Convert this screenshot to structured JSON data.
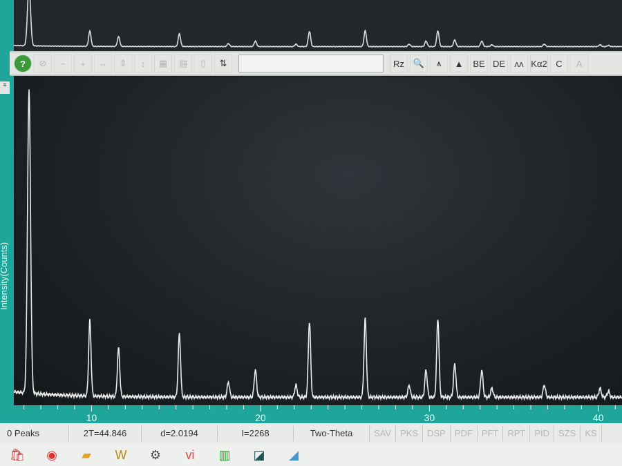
{
  "toolbar": {
    "buttons": [
      {
        "name": "help",
        "glyph": "?",
        "active": true
      },
      {
        "name": "stop",
        "glyph": "⊘",
        "active": false
      },
      {
        "name": "minus",
        "glyph": "−",
        "active": false
      },
      {
        "name": "plus",
        "glyph": "+",
        "active": false
      },
      {
        "name": "expand-h",
        "glyph": "⇔",
        "active": false
      },
      {
        "name": "expand-v",
        "glyph": "⇕",
        "active": false
      },
      {
        "name": "scale-v",
        "glyph": "↕",
        "active": false
      },
      {
        "name": "grid",
        "glyph": "▦",
        "active": false
      },
      {
        "name": "grid2",
        "glyph": "▤",
        "active": false
      },
      {
        "name": "blank",
        "glyph": "▯",
        "active": false
      },
      {
        "name": "spin",
        "glyph": "⇅",
        "active": true
      }
    ],
    "right_buttons": [
      {
        "name": "rz",
        "glyph": "Rz",
        "active": true
      },
      {
        "name": "zoom",
        "glyph": "🔍",
        "active": true
      },
      {
        "name": "peak-label",
        "glyph": "⩚",
        "active": true
      },
      {
        "name": "peak-fill",
        "glyph": "▲",
        "active": true
      },
      {
        "name": "be",
        "glyph": "BE",
        "active": true
      },
      {
        "name": "de",
        "glyph": "DE",
        "active": true
      },
      {
        "name": "profile",
        "glyph": "ʌʌ",
        "active": true
      },
      {
        "name": "ka2",
        "glyph": "Kα2",
        "active": true
      },
      {
        "name": "c",
        "glyph": "C",
        "active": true
      },
      {
        "name": "disabled",
        "glyph": "A",
        "active": false
      }
    ]
  },
  "side_button": "≡",
  "status": {
    "peaks": "0 Peaks",
    "two_theta": "2T=44.846",
    "d": "d=2.0194",
    "intensity": "I=2268",
    "mode": "Two-Theta",
    "tabs": [
      "SAV",
      "PKS",
      "DSP",
      "PDF",
      "PFT",
      "RPT",
      "PID",
      "SZS",
      "KS"
    ]
  },
  "taskbar": [
    "store",
    "chrome",
    "explorer",
    "w-app",
    "settings",
    "vi-app",
    "chart-app",
    "image-app",
    "jade-app"
  ],
  "colors": {
    "teal": "#1fa59a",
    "trace": "#e6e6e6",
    "bg": "#1d2124"
  },
  "chart_data": {
    "type": "line",
    "title": "",
    "xlabel": "Two-Theta",
    "ylabel": "Intensity(Counts)",
    "xlim": [
      5.4,
      41.4
    ],
    "ylim_relative": [
      0,
      100
    ],
    "x_ticks": [
      10,
      20,
      30,
      40
    ],
    "grid": false,
    "peaks": [
      {
        "two_theta": 6.3,
        "rel_intensity": 100
      },
      {
        "two_theta": 9.9,
        "rel_intensity": 25
      },
      {
        "two_theta": 11.6,
        "rel_intensity": 16
      },
      {
        "two_theta": 15.2,
        "rel_intensity": 21
      },
      {
        "two_theta": 18.1,
        "rel_intensity": 5
      },
      {
        "two_theta": 19.7,
        "rel_intensity": 9
      },
      {
        "two_theta": 22.1,
        "rel_intensity": 4
      },
      {
        "two_theta": 22.9,
        "rel_intensity": 25
      },
      {
        "two_theta": 26.2,
        "rel_intensity": 26
      },
      {
        "two_theta": 28.8,
        "rel_intensity": 4
      },
      {
        "two_theta": 29.8,
        "rel_intensity": 9
      },
      {
        "two_theta": 30.5,
        "rel_intensity": 26
      },
      {
        "two_theta": 31.5,
        "rel_intensity": 11
      },
      {
        "two_theta": 33.1,
        "rel_intensity": 9
      },
      {
        "two_theta": 33.7,
        "rel_intensity": 3
      },
      {
        "two_theta": 36.8,
        "rel_intensity": 4
      },
      {
        "two_theta": 40.1,
        "rel_intensity": 3
      },
      {
        "two_theta": 40.6,
        "rel_intensity": 2
      }
    ]
  }
}
